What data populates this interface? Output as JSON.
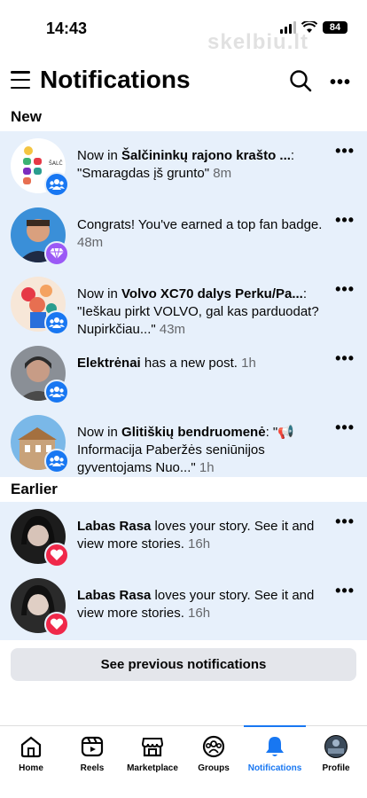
{
  "status": {
    "time": "14:43",
    "battery": "84",
    "watermark": "skelbiu.lt"
  },
  "header": {
    "title": "Notifications"
  },
  "sections": {
    "new": "New",
    "earlier": "Earlier"
  },
  "notifications": [
    {
      "pre": "Now in ",
      "bold": "Šalčininkų rajono krašto ...",
      "post": ": \"Smaragdas įš grunto\"",
      "time": "8m",
      "badge": "group-icon"
    },
    {
      "pre": "Congrats! You've earned a top fan badge.",
      "bold": "",
      "post": "",
      "time": "48m",
      "badge": "diamond-icon"
    },
    {
      "pre": "Now in ",
      "bold": "Volvo XC70 dalys Perku/Pa...",
      "post": ": \"Ieškau pirkt VOLVO, gal kas parduodat? Nupirkčiau...\"",
      "time": "43m",
      "badge": "group-icon"
    },
    {
      "pre": "",
      "bold": "Elektrėnai",
      "post": " has a new post.",
      "time": "1h",
      "badge": "group-icon"
    },
    {
      "pre": "Now in ",
      "bold": "Glitiškių bendruomenė",
      "post": ": \"📢 Informacija Paberžės seniūnijos gyventojams Nuo...\"",
      "time": "1h",
      "badge": "group-icon"
    },
    {
      "pre": "",
      "bold": "Labas Rasa",
      "post": " loves your story. See it and view more stories.",
      "time": "16h",
      "badge": "heart-icon"
    },
    {
      "pre": "",
      "bold": "Labas Rasa",
      "post": " loves your story. See it and view more stories.",
      "time": "16h",
      "badge": "heart-icon"
    }
  ],
  "see_previous": "See previous notifications",
  "tabs": [
    {
      "label": "Home",
      "icon": "home-icon"
    },
    {
      "label": "Reels",
      "icon": "reels-icon"
    },
    {
      "label": "Marketplace",
      "icon": "marketplace-icon"
    },
    {
      "label": "Groups",
      "icon": "groups-icon"
    },
    {
      "label": "Notifications",
      "icon": "bell-icon",
      "active": true
    },
    {
      "label": "Profile",
      "icon": "profile-avatar"
    }
  ],
  "colors": {
    "accent": "#1877f2",
    "unread_bg": "#e7f0fb",
    "heart": "#f0284a"
  }
}
